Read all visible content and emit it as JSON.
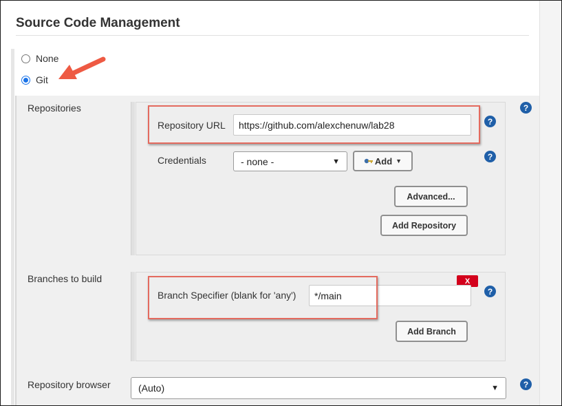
{
  "section": {
    "title": "Source Code Management"
  },
  "scm_options": [
    {
      "label": "None",
      "selected": false
    },
    {
      "label": "Git",
      "selected": true
    }
  ],
  "repositories": {
    "label": "Repositories",
    "url_label": "Repository URL",
    "url_value": "https://github.com/alexchenuw/lab28",
    "credentials_label": "Credentials",
    "credentials_value": "- none -",
    "add_button": "Add",
    "advanced_button": "Advanced...",
    "add_repository_button": "Add Repository"
  },
  "branches": {
    "label": "Branches to build",
    "delete_label": "X",
    "specifier_label": "Branch Specifier (blank for 'any')",
    "specifier_value": "*/main",
    "add_branch_button": "Add Branch"
  },
  "browser": {
    "label": "Repository browser",
    "value": "(Auto)"
  },
  "help_glyph": "?",
  "colors": {
    "highlight": "#e46a5e",
    "arrow": "#ee5a43",
    "help": "#1f5fa8",
    "radio_accent": "#1a73e8",
    "delete": "#d3001b"
  }
}
